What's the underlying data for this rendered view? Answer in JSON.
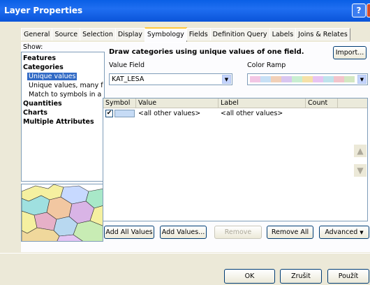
{
  "window": {
    "title": "Layer Properties",
    "help_glyph": "?"
  },
  "tabs": [
    "General",
    "Source",
    "Selection",
    "Display",
    "Symbology",
    "Fields",
    "Definition Query",
    "Labels",
    "Joins & Relates"
  ],
  "active_tab": "Symbology",
  "show_label": "Show:",
  "tree": {
    "features": "Features",
    "categories": "Categories",
    "unique_values": "Unique values",
    "unique_values_many": "Unique values, many f",
    "match_symbols": "Match to symbols in a",
    "quantities": "Quantities",
    "charts": "Charts",
    "multiple_attributes": "Multiple Attributes"
  },
  "heading": "Draw categories using unique values of one field.",
  "import_button": "Import...",
  "value_field": {
    "label": "Value Field",
    "value": "KAT_LESA"
  },
  "color_ramp": {
    "label": "Color Ramp",
    "colors": [
      "#f2c6e4",
      "#c7e0f5",
      "#f1d0b8",
      "#d9c6f0",
      "#c9eed1",
      "#f5e1a8",
      "#e7c4f2",
      "#bfe3ec",
      "#f2c4cb",
      "#d3e7c2"
    ]
  },
  "table": {
    "columns": [
      "Symbol",
      "Value",
      "Label",
      "Count"
    ],
    "rows": [
      {
        "value": "<all other values>",
        "label": "<all other values>",
        "count": ""
      }
    ]
  },
  "buttons": {
    "add_all": "Add All Values",
    "add_values": "Add Values...",
    "remove": "Remove",
    "remove_all": "Remove All",
    "advanced": "Advanced"
  },
  "dialog_buttons": {
    "ok": "OK",
    "cancel": "Zrušit",
    "apply": "Použít"
  }
}
